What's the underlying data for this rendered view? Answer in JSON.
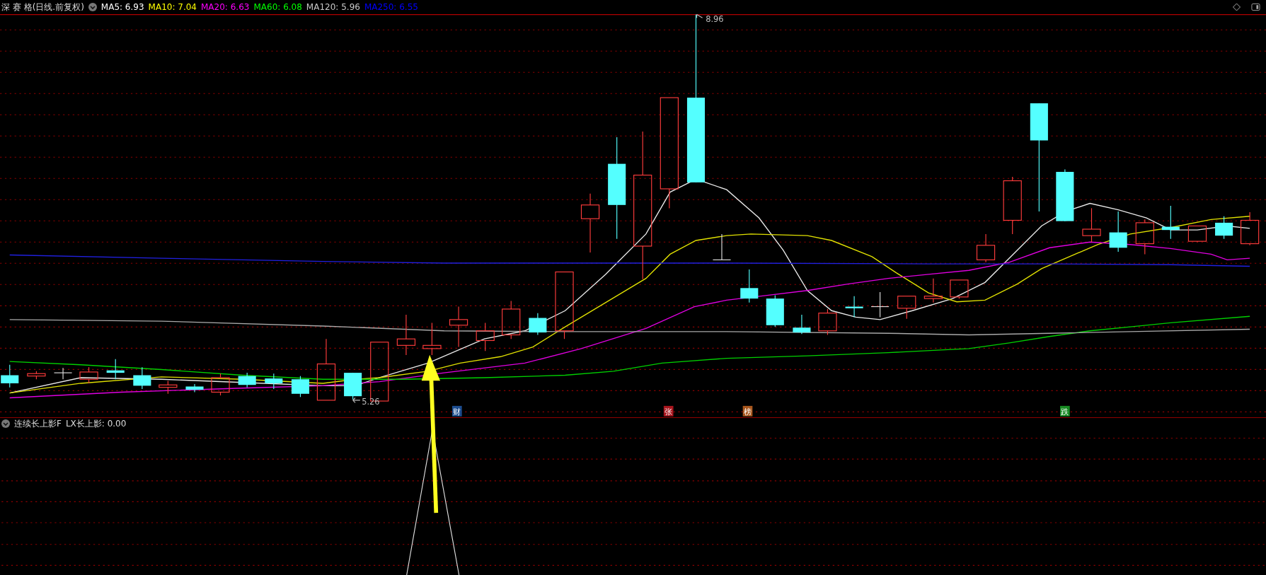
{
  "header": {
    "title": "深 赛 格(日线.前复权)",
    "ma_values": [
      {
        "label": "MA5: 6.93",
        "color": "#ffffff"
      },
      {
        "label": "MA10: 7.04",
        "color": "#ffff00"
      },
      {
        "label": "MA20: 6.63",
        "color": "#ff00ff"
      },
      {
        "label": "MA60: 6.08",
        "color": "#00ff00"
      },
      {
        "label": "MA120: 5.96",
        "color": "#c8c8c8"
      },
      {
        "label": "MA250: 6.55",
        "color": "#0000ff"
      }
    ]
  },
  "chart": {
    "high_label": "8.96",
    "low_label": "5.26",
    "badges": [
      {
        "text": "财",
        "color": "#1d4d8f"
      },
      {
        "text": "张",
        "color": "#a8141c"
      },
      {
        "text": "榜",
        "color": "#a8561c"
      },
      {
        "text": "跌",
        "color": "#178a22"
      }
    ]
  },
  "indicator": {
    "title": "连续长上影F",
    "value": "LX长上影: 0.00"
  }
}
